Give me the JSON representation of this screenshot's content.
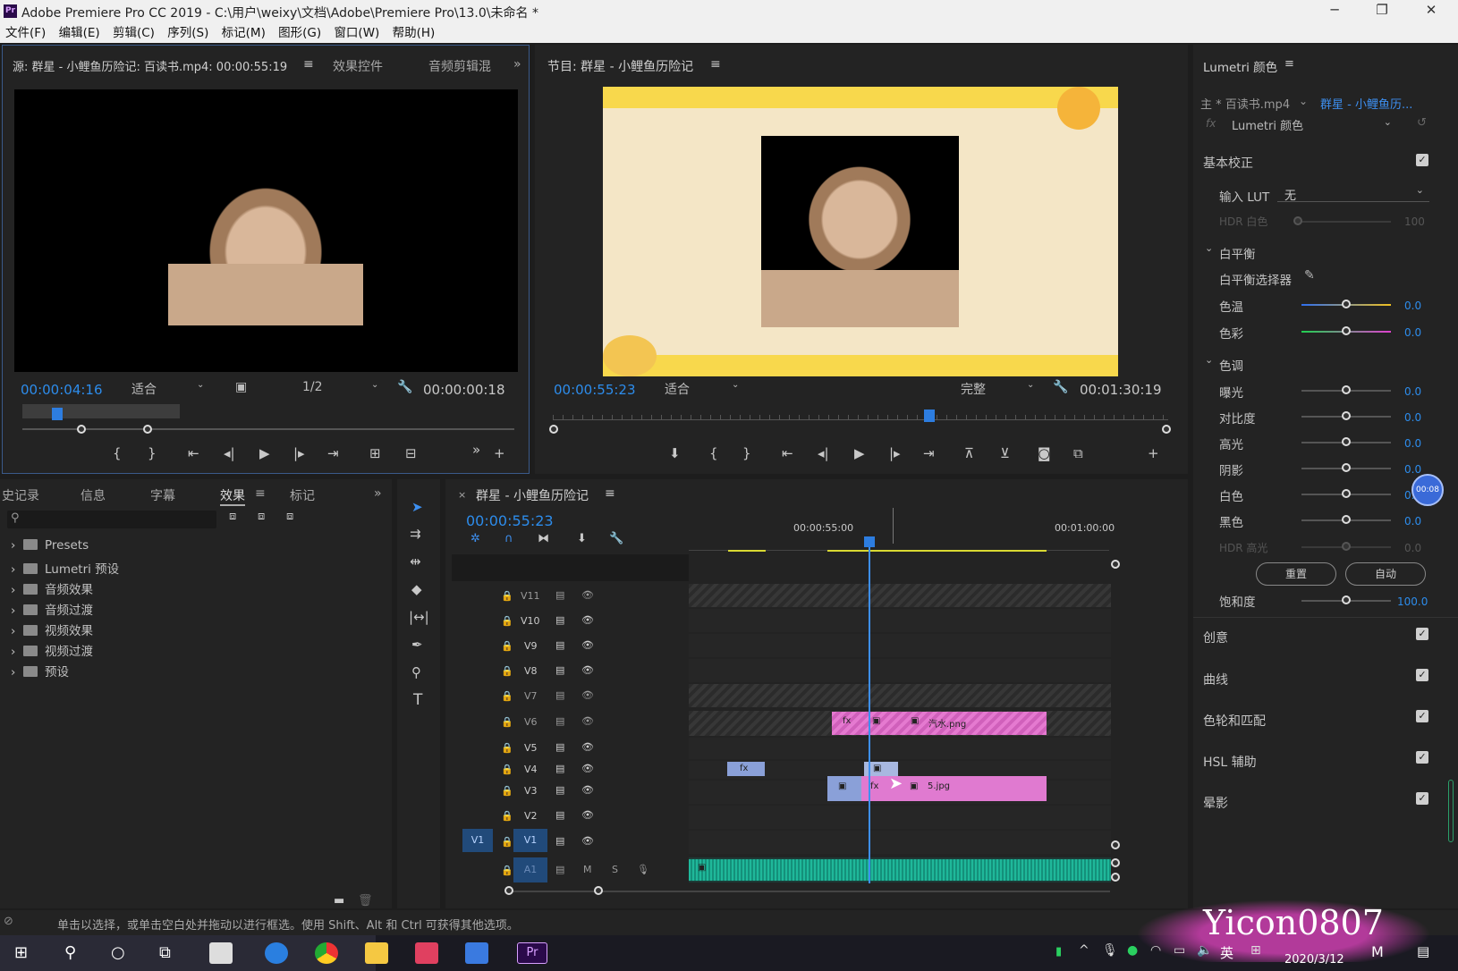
{
  "window": {
    "title": "Adobe Premiere Pro CC 2019 - C:\\用户\\weixy\\文档\\Adobe\\Premiere Pro\\13.0\\未命名 *",
    "app_icon": "Pr"
  },
  "menu": [
    "文件(F)",
    "编辑(E)",
    "剪辑(C)",
    "序列(S)",
    "标记(M)",
    "图形(G)",
    "窗口(W)",
    "帮助(H)"
  ],
  "source_monitor": {
    "tab_source": "源: 群星 - 小鲤鱼历险记: 百读书.mp4: 00:00:55:19",
    "tab_effects": "效果控件",
    "tab_audio": "音频剪辑混",
    "current_tc": "00:00:04:16",
    "zoom": "适合",
    "resolution": "1/2",
    "duration_tc": "00:00:00:18"
  },
  "program_monitor": {
    "tab": "节目: 群星 - 小鲤鱼历险记",
    "current_tc": "00:00:55:23",
    "zoom": "适合",
    "quality": "完整",
    "duration_tc": "00:01:30:19"
  },
  "effects_panel": {
    "tabs": [
      "史记录",
      "信息",
      "字幕",
      "效果",
      "标记"
    ],
    "active_tab": "效果",
    "items": [
      "Presets",
      "Lumetri 预设",
      "音频效果",
      "音频过渡",
      "视频效果",
      "视频过渡",
      "预设"
    ]
  },
  "timeline": {
    "tab": "群星 - 小鲤鱼历险记",
    "current_tc": "00:00:55:23",
    "ruler_labels": [
      "00:00:55:00",
      "00:01:00:00"
    ],
    "tracks": [
      "V11",
      "V10",
      "V9",
      "V8",
      "V7",
      "V6",
      "V5",
      "V4",
      "V3",
      "V2",
      "V1",
      "A1"
    ],
    "clip_v6": "汽水.png",
    "clip_v3": "5.jpg",
    "source_patch_v1": "V1"
  },
  "lumetri": {
    "title": "Lumetri 颜色",
    "master": "主 * 百读书.mp4",
    "sequence": "群星 - 小鲤鱼历...",
    "effect": "Lumetri 颜色",
    "basic_correction": "基本校正",
    "input_lut_label": "输入 LUT",
    "input_lut_value": "无",
    "hdr_white_label": "HDR 白色",
    "hdr_white_value": "100",
    "white_balance": "白平衡",
    "wb_selector": "白平衡选择器",
    "temp_label": "色温",
    "temp_value": "0.0",
    "tint_label": "色彩",
    "tint_value": "0.0",
    "tone": "色调",
    "exposure_label": "曝光",
    "exposure_value": "0.0",
    "contrast_label": "对比度",
    "contrast_value": "0.0",
    "highlights_label": "高光",
    "highlights_value": "0.0",
    "shadows_label": "阴影",
    "shadows_value": "0.0",
    "whites_label": "白色",
    "whites_value": "0.0",
    "blacks_label": "黑色",
    "blacks_value": "0.0",
    "hdr_spec_label": "HDR 高光",
    "hdr_spec_value": "0.0",
    "reset_button": "重置",
    "auto_button": "自动",
    "saturation_label": "饱和度",
    "saturation_value": "100.0",
    "sections": [
      "创意",
      "曲线",
      "色轮和匹配",
      "HSL 辅助",
      "晕影"
    ],
    "badge": "00:08"
  },
  "status_bar": "单击以选择，或单击空白处并拖动以进行框选。使用 Shift、Alt 和 Ctrl 可获得其他选项。",
  "taskbar": {
    "ime": "英",
    "date": "2020/3/12",
    "watermark": "Yicon0807"
  }
}
